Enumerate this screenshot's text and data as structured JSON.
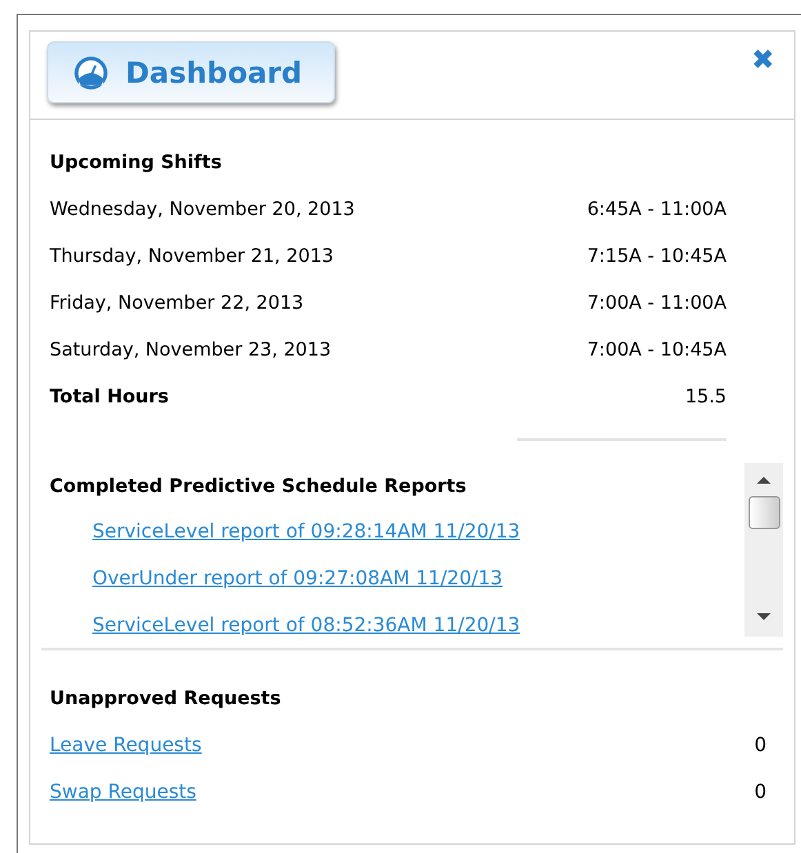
{
  "header": {
    "title": "Dashboard",
    "close": "✖"
  },
  "upcoming_shifts": {
    "heading": "Upcoming Shifts",
    "rows": [
      {
        "date": "Wednesday, November 20, 2013",
        "time": "6:45A - 11:00A"
      },
      {
        "date": "Thursday, November 21, 2013",
        "time": "7:15A - 10:45A"
      },
      {
        "date": "Friday, November 22, 2013",
        "time": "7:00A - 11:00A"
      },
      {
        "date": "Saturday, November 23, 2013",
        "time": "7:00A - 10:45A"
      }
    ],
    "total": {
      "label": "Total Hours",
      "value": "15.5"
    }
  },
  "reports": {
    "heading": "Completed Predictive Schedule Reports",
    "items": [
      "ServiceLevel report of 09:28:14AM 11/20/13",
      "OverUnder report of 09:27:08AM 11/20/13",
      "ServiceLevel report of 08:52:36AM 11/20/13"
    ]
  },
  "unapproved_requests": {
    "heading": "Unapproved Requests",
    "rows": [
      {
        "label": "Leave Requests",
        "count": "0"
      },
      {
        "label": "Swap Requests",
        "count": "0"
      }
    ]
  }
}
